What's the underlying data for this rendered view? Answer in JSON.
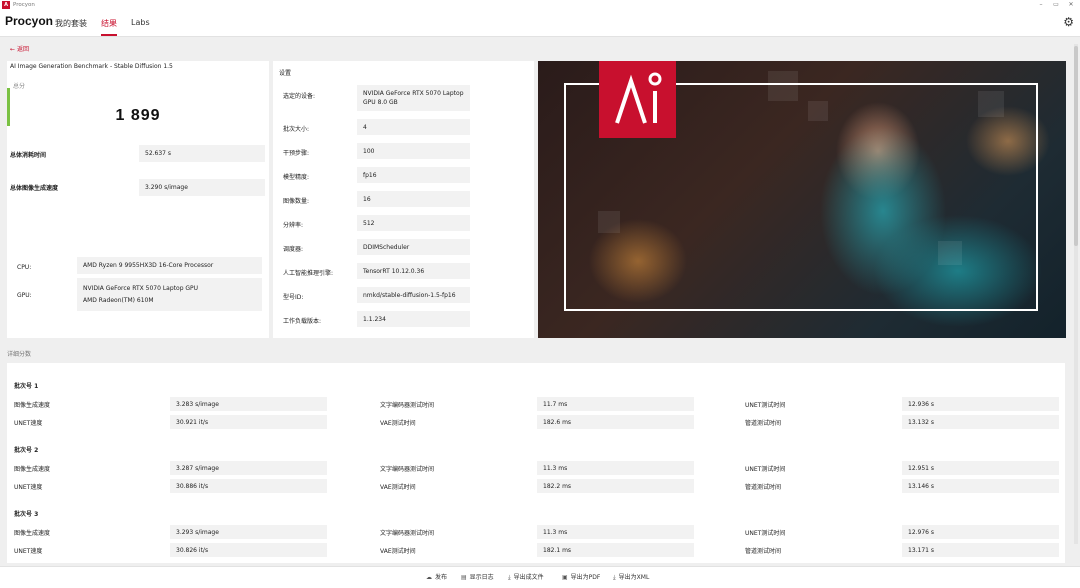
{
  "window": {
    "title": "Procyon",
    "controls": [
      "–",
      "▭",
      "✕"
    ]
  },
  "nav": {
    "brand": "Procyon",
    "tabs": [
      {
        "label": "我的套装",
        "active": false
      },
      {
        "label": "结果",
        "active": true
      },
      {
        "label": "Labs",
        "active": false
      }
    ]
  },
  "back": {
    "label": "返回"
  },
  "summary": {
    "benchmark_title": "AI Image Generation Benchmark - Stable Diffusion 1.5",
    "score_label": "总分",
    "score": "1 899",
    "metrics": [
      {
        "label": "总体消耗时间",
        "value": "52.637 s"
      },
      {
        "label": "总体图像生成速度",
        "value": "3.290 s/image"
      }
    ],
    "cpu_label": "CPU:",
    "cpu_value": "AMD Ryzen 9 9955HX3D 16-Core Processor",
    "gpu_label": "GPU:",
    "gpu_values": [
      "NVIDIA GeForce RTX 5070 Laptop GPU",
      "AMD Radeon(TM) 610M"
    ]
  },
  "settings": {
    "title": "设置",
    "rows": [
      {
        "label": "选定的设备:",
        "value": "NVIDIA GeForce RTX 5070 Laptop GPU 8.0 GB"
      },
      {
        "label": "批次大小:",
        "value": "4"
      },
      {
        "label": "干预步骤:",
        "value": "100"
      },
      {
        "label": "模型精度:",
        "value": "fp16"
      },
      {
        "label": "图像数量:",
        "value": "16"
      },
      {
        "label": "分辨率:",
        "value": "512"
      },
      {
        "label": "调度器:",
        "value": "DDIMScheduler"
      },
      {
        "label": "人工智能推理引擎:",
        "value": "TensorRT 10.12.0.36"
      },
      {
        "label": "型号ID:",
        "value": "nmkd/stable-diffusion-1.5-fp16"
      },
      {
        "label": "工作负载版本:",
        "value": "1.1.234"
      }
    ]
  },
  "details": {
    "title": "详细分数",
    "batches": [
      {
        "title": "批次号 1",
        "rows": [
          [
            {
              "label": "图像生成速度",
              "value": "3.283 s/image"
            },
            {
              "label": "文字编码器测试时间",
              "value": "11.7 ms"
            },
            {
              "label": "UNET测试时间",
              "value": "12.936 s"
            }
          ],
          [
            {
              "label": "UNET速度",
              "value": "30.921 it/s"
            },
            {
              "label": "VAE测试时间",
              "value": "182.6 ms"
            },
            {
              "label": "管道测试时间",
              "value": "13.132 s"
            }
          ]
        ]
      },
      {
        "title": "批次号 2",
        "rows": [
          [
            {
              "label": "图像生成速度",
              "value": "3.287 s/image"
            },
            {
              "label": "文字编码器测试时间",
              "value": "11.3 ms"
            },
            {
              "label": "UNET测试时间",
              "value": "12.951 s"
            }
          ],
          [
            {
              "label": "UNET速度",
              "value": "30.886 it/s"
            },
            {
              "label": "VAE测试时间",
              "value": "182.2 ms"
            },
            {
              "label": "管道测试时间",
              "value": "13.146 s"
            }
          ]
        ]
      },
      {
        "title": "批次号 3",
        "rows": [
          [
            {
              "label": "图像生成速度",
              "value": "3.293 s/image"
            },
            {
              "label": "文字编码器测试时间",
              "value": "11.3 ms"
            },
            {
              "label": "UNET测试时间",
              "value": "12.976 s"
            }
          ],
          [
            {
              "label": "UNET速度",
              "value": "30.826 it/s"
            },
            {
              "label": "VAE测试时间",
              "value": "182.1 ms"
            },
            {
              "label": "管道测试时间",
              "value": "13.171 s"
            }
          ]
        ]
      }
    ]
  },
  "footer": {
    "buttons": [
      {
        "label": "发布",
        "icon": "cloud-upload-icon",
        "glyph": "☁"
      },
      {
        "label": "显示日志",
        "icon": "log-icon",
        "glyph": "▤"
      },
      {
        "label": "导出成文件",
        "icon": "download-icon",
        "glyph": "⤓"
      },
      {
        "label": "导出为PDF",
        "icon": "pdf-icon",
        "glyph": "▣"
      },
      {
        "label": "导出为XML",
        "icon": "download-icon",
        "glyph": "⤓"
      }
    ]
  },
  "colors": {
    "accent": "#c8102e",
    "score_bar": "#7ac143"
  }
}
